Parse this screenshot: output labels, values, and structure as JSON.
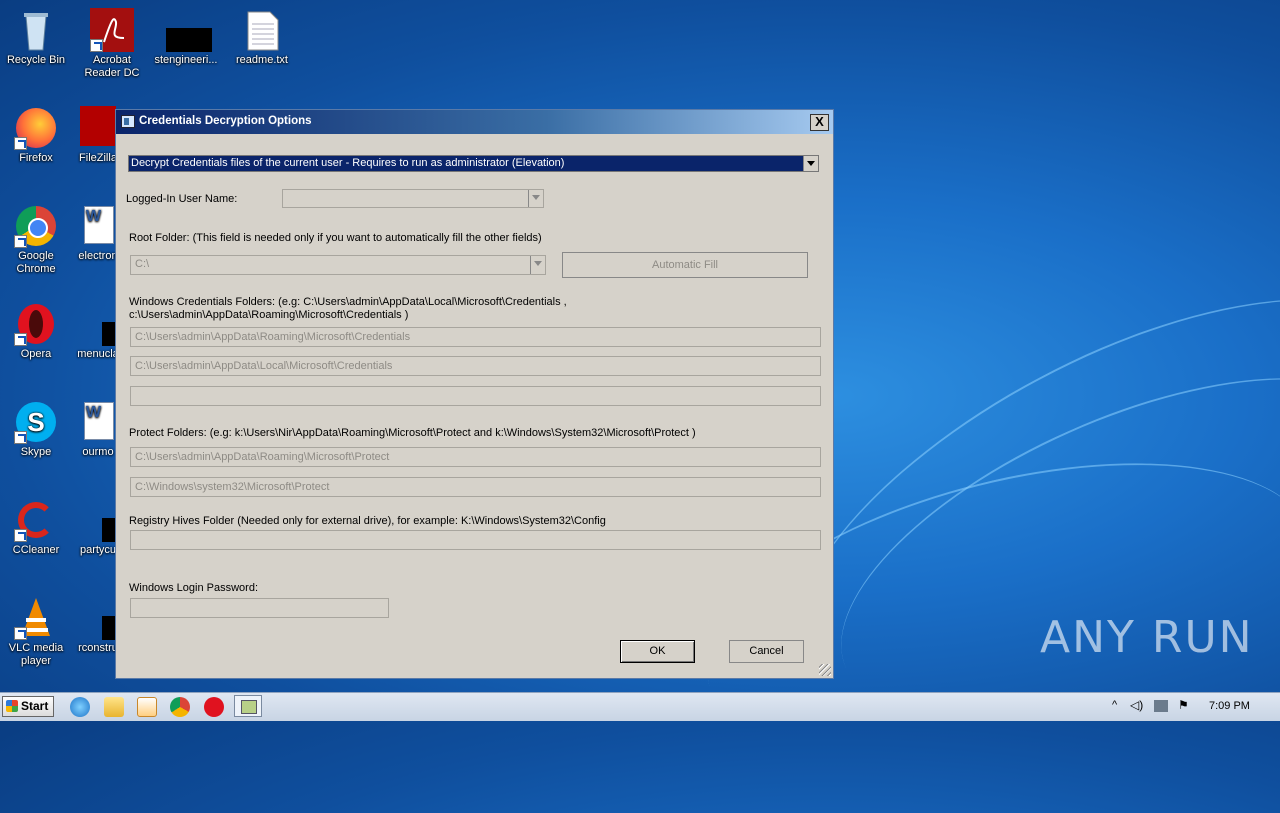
{
  "desktop": {
    "icons": [
      {
        "label": "Recycle Bin",
        "icon": "recycle-bin-icon"
      },
      {
        "label": "Acrobat Reader DC",
        "icon": "acrobat-icon"
      },
      {
        "label": "stengineeri...",
        "icon": "black-file-icon"
      },
      {
        "label": "readme.txt",
        "icon": "text-file-icon"
      },
      {
        "label": "Firefox",
        "icon": "firefox-icon"
      },
      {
        "label": "FileZilla",
        "icon": "filezilla-icon"
      },
      {
        "label": "Google Chrome",
        "icon": "chrome-icon"
      },
      {
        "label": "electron",
        "icon": "word-doc-icon"
      },
      {
        "label": "Opera",
        "icon": "opera-icon"
      },
      {
        "label": "menucla",
        "icon": "black-file-icon"
      },
      {
        "label": "Skype",
        "icon": "skype-icon"
      },
      {
        "label": "ourmo",
        "icon": "word-doc-icon"
      },
      {
        "label": "CCleaner",
        "icon": "ccleaner-icon"
      },
      {
        "label": "partycu",
        "icon": "black-file-icon"
      },
      {
        "label": "VLC media player",
        "icon": "vlc-icon"
      },
      {
        "label": "rconstru",
        "icon": "black-file-icon"
      }
    ],
    "watermark": "ANY RUN"
  },
  "dialog": {
    "title": "Credentials Decryption Options",
    "close_label": "X",
    "mode_select": "Decrypt Credentials files of the current user - Requires to run as administrator (Elevation)",
    "logged_in_label": "Logged-In User Name:",
    "logged_in_value": "",
    "root_folder_label": "Root Folder: (This field is needed only if you want to automatically fill the other fields)",
    "root_folder_value": "C:\\",
    "automatic_fill_label": "Automatic Fill",
    "win_cred_label_line1": "Windows Credentials Folders:  (e.g: C:\\Users\\admin\\AppData\\Local\\Microsoft\\Credentials ,",
    "win_cred_label_line2": "c:\\Users\\admin\\AppData\\Roaming\\Microsoft\\Credentials )",
    "win_cred_fields": [
      "C:\\Users\\admin\\AppData\\Roaming\\Microsoft\\Credentials",
      "C:\\Users\\admin\\AppData\\Local\\Microsoft\\Credentials",
      ""
    ],
    "protect_label": "Protect Folders: (e.g: k:\\Users\\Nir\\AppData\\Roaming\\Microsoft\\Protect and k:\\Windows\\System32\\Microsoft\\Protect )",
    "protect_fields": [
      "C:\\Users\\admin\\AppData\\Roaming\\Microsoft\\Protect",
      "C:\\Windows\\system32\\Microsoft\\Protect"
    ],
    "registry_label": "Registry Hives Folder (Needed only for external drive), for example:  K:\\Windows\\System32\\Config",
    "registry_value": "",
    "password_label": "Windows Login Password:",
    "password_value": "",
    "ok_label": "OK",
    "cancel_label": "Cancel"
  },
  "taskbar": {
    "start_label": "Start",
    "clock": "7:09 PM"
  }
}
